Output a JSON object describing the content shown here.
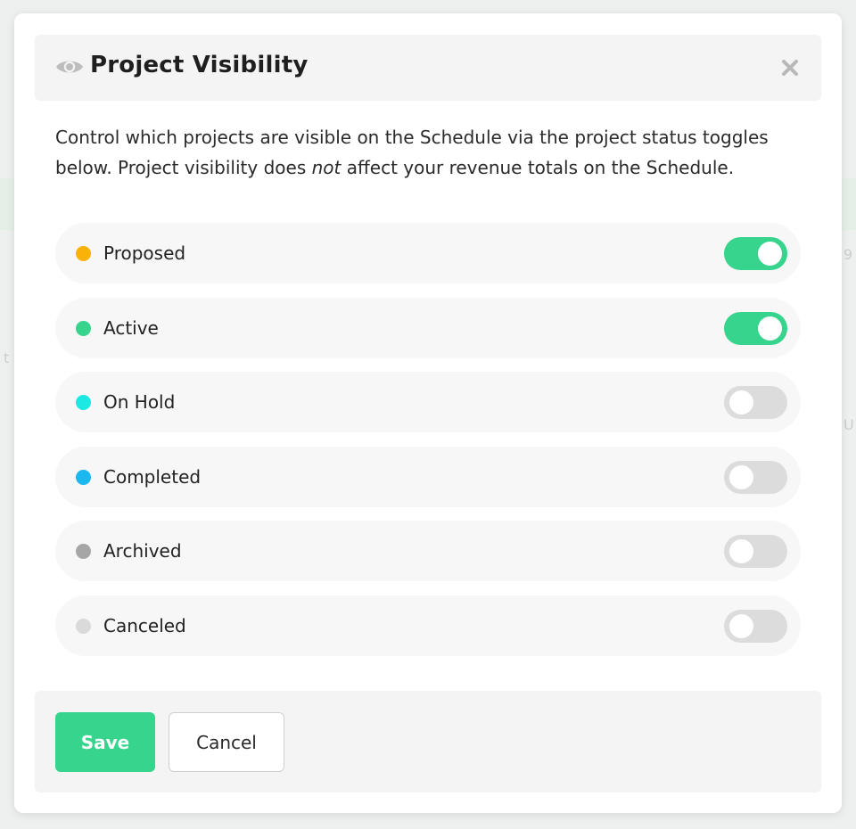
{
  "dialog": {
    "title": "Project Visibility",
    "title_icon": "eye-icon",
    "close_icon": "close-icon",
    "description_part1": "Control which projects are visible on the Schedule via the project status toggles below. Project visibility does ",
    "description_emphasis": "not",
    "description_part2": " affect your revenue totals on the Schedule."
  },
  "statuses": [
    {
      "label": "Proposed",
      "color": "#f9b208",
      "enabled": true
    },
    {
      "label": "Active",
      "color": "#36d48c",
      "enabled": true
    },
    {
      "label": "On Hold",
      "color": "#1de9e2",
      "enabled": false
    },
    {
      "label": "Completed",
      "color": "#1ab8ef",
      "enabled": false
    },
    {
      "label": "Archived",
      "color": "#a6a6a6",
      "enabled": false
    },
    {
      "label": "Canceled",
      "color": "#dadada",
      "enabled": false
    }
  ],
  "footer": {
    "save_label": "Save",
    "cancel_label": "Cancel"
  },
  "colors": {
    "accent": "#36d48c",
    "toggle_off": "#dcdcdc",
    "header_bg": "#f4f4f4"
  }
}
